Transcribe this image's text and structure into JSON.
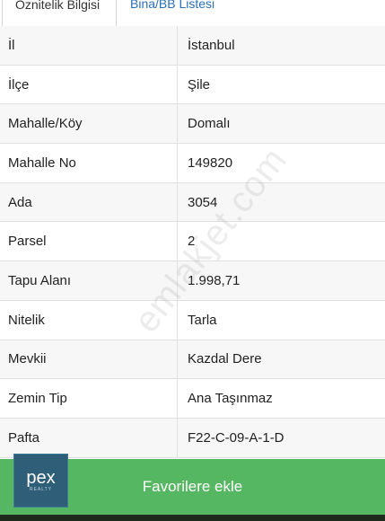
{
  "tabs": [
    {
      "label": "Öznitelik Bilgisi",
      "active": true
    },
    {
      "label": "Bina/BB Listesi",
      "active": false
    }
  ],
  "rows": [
    {
      "key": "İl",
      "value": "İstanbul"
    },
    {
      "key": "İlçe",
      "value": "Şile"
    },
    {
      "key": "Mahalle/Köy",
      "value": "Domalı"
    },
    {
      "key": "Mahalle No",
      "value": "149820"
    },
    {
      "key": "Ada",
      "value": "3054"
    },
    {
      "key": "Parsel",
      "value": "2"
    },
    {
      "key": "Tapu Alanı",
      "value": "1.998,71"
    },
    {
      "key": "Nitelik",
      "value": "Tarla"
    },
    {
      "key": "Mevkii",
      "value": "Kazdal Dere"
    },
    {
      "key": "Zemin Tip",
      "value": "Ana Taşınmaz"
    },
    {
      "key": "Pafta",
      "value": "F22-C-09-A-1-D"
    }
  ],
  "watermark": "emlakjet.com",
  "favorite_button": {
    "label": "Favorilere ekle"
  },
  "logo": {
    "main": "pex",
    "sub": "REALTY"
  },
  "colors": {
    "favorite_bar": "#56b763",
    "tab_link": "#2a6fb6",
    "logo_bg": "#2f5f78"
  }
}
